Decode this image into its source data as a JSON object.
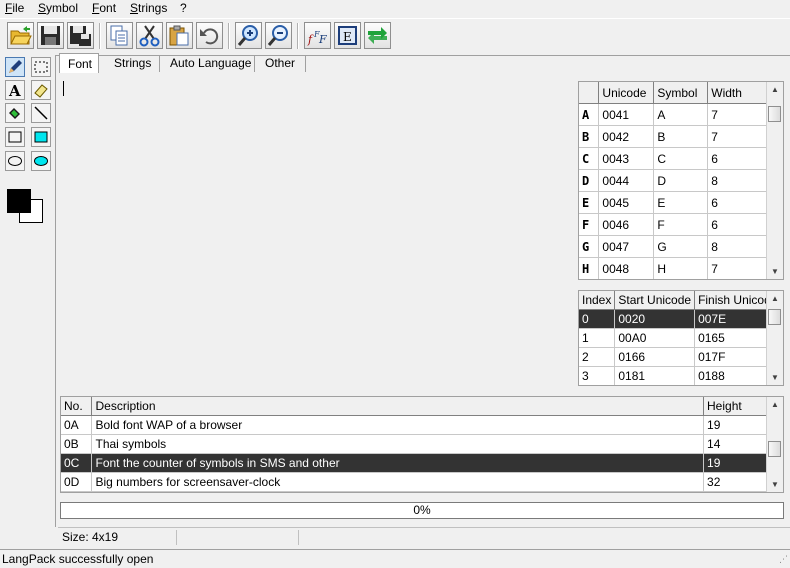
{
  "menu": {
    "file": "File",
    "symbol": "Symbol",
    "font": "Font",
    "strings": "Strings",
    "help": "?"
  },
  "tabs": [
    {
      "label": "Font"
    },
    {
      "label": "Strings"
    },
    {
      "label": "Auto Language"
    },
    {
      "label": "Other"
    }
  ],
  "symbols_table": {
    "headers": [
      "Unicode",
      "Symbol",
      "Width"
    ],
    "rows": [
      {
        "glyph": "A",
        "unicode": "0041",
        "symbol": "A",
        "width": "7"
      },
      {
        "glyph": "B",
        "unicode": "0042",
        "symbol": "B",
        "width": "7"
      },
      {
        "glyph": "C",
        "unicode": "0043",
        "symbol": "C",
        "width": "6"
      },
      {
        "glyph": "D",
        "unicode": "0044",
        "symbol": "D",
        "width": "8"
      },
      {
        "glyph": "E",
        "unicode": "0045",
        "symbol": "E",
        "width": "6"
      },
      {
        "glyph": "F",
        "unicode": "0046",
        "symbol": "F",
        "width": "6"
      },
      {
        "glyph": "G",
        "unicode": "0047",
        "symbol": "G",
        "width": "8"
      },
      {
        "glyph": "H",
        "unicode": "0048",
        "symbol": "H",
        "width": "7"
      }
    ]
  },
  "ranges_table": {
    "headers": [
      "Index",
      "Start Unicode",
      "Finish Unicode"
    ],
    "rows": [
      {
        "index": "0",
        "start": "0020",
        "finish": "007E"
      },
      {
        "index": "1",
        "start": "00A0",
        "finish": "0165"
      },
      {
        "index": "2",
        "start": "0166",
        "finish": "017F"
      },
      {
        "index": "3",
        "start": "0181",
        "finish": "0188"
      }
    ],
    "selected_index": 0
  },
  "fonts_table": {
    "headers": [
      "No.",
      "Description",
      "Height"
    ],
    "rows": [
      {
        "no": "0A",
        "description": "Bold font WAP of a browser",
        "height": "19"
      },
      {
        "no": "0B",
        "description": "Thai symbols",
        "height": "14"
      },
      {
        "no": "0C",
        "description": "Font the counter of symbols in SMS and other",
        "height": "19"
      },
      {
        "no": "0D",
        "description": "Big numbers for screensaver-clock",
        "height": "32"
      }
    ],
    "selected_index": 2
  },
  "progress": {
    "text": "0%",
    "value": 0
  },
  "size_status": "Size: 4x19",
  "status_message": "LangPack successfully open",
  "colors": {
    "foreground": "#000000",
    "background": "#ffffff",
    "selection": "#333333",
    "fill_swatch": "#00e5ee"
  }
}
